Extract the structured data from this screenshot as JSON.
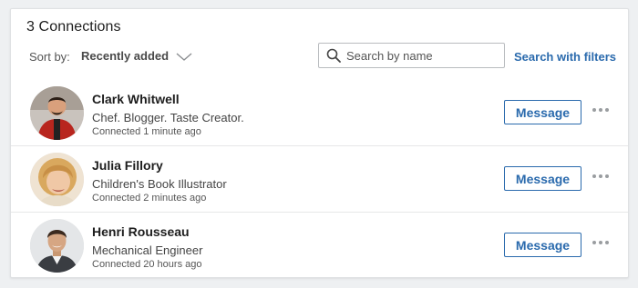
{
  "header": {
    "title": "3 Connections",
    "sort_label": "Sort by:",
    "sort_value": "Recently added",
    "search_placeholder": "Search by name",
    "search_value": "",
    "filters_link": "Search with filters"
  },
  "connections": [
    {
      "name": "Clark Whitwell",
      "headline": "Chef. Blogger. Taste Creator.",
      "connected": "Connected 1 minute ago",
      "message_label": "Message"
    },
    {
      "name": "Julia Fillory",
      "headline": "Children's Book Illustrator",
      "connected": "Connected 2 minutes ago",
      "message_label": "Message"
    },
    {
      "name": "Henri Rousseau",
      "headline": "Mechanical Engineer",
      "connected": "Connected 20 hours ago",
      "message_label": "Message"
    }
  ],
  "colors": {
    "accent": "#2a6aad",
    "card_bg": "#ffffff",
    "page_bg": "#eef0f2"
  },
  "icons": {
    "sort": "chevron-down-icon",
    "search": "search-icon",
    "more": "more-options-icon"
  }
}
